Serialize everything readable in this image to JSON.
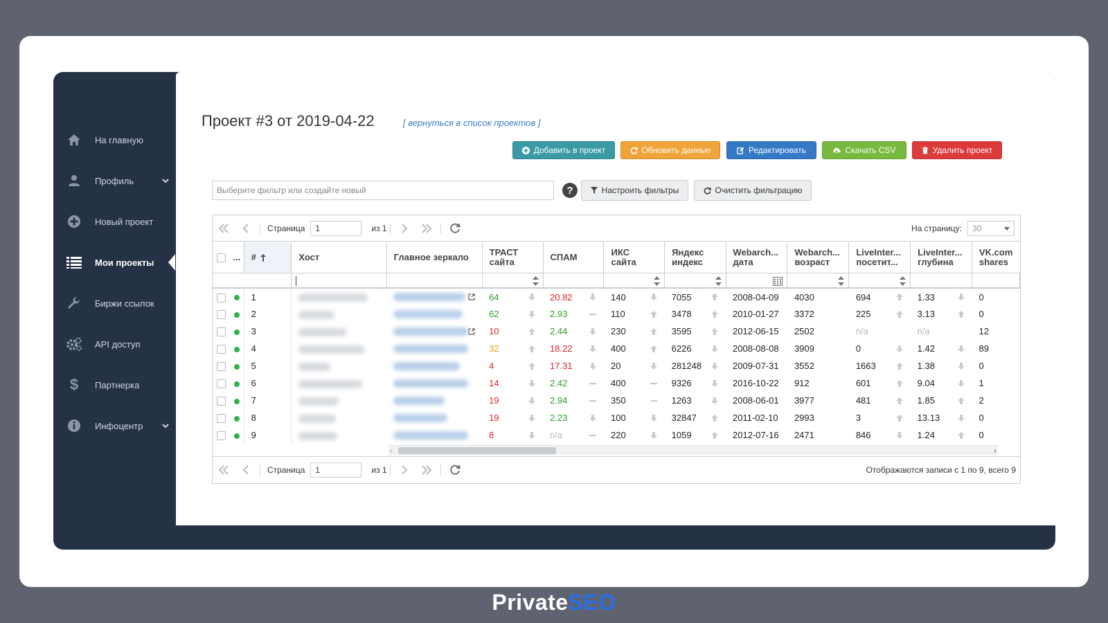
{
  "sidebar": {
    "items": [
      {
        "label": "На главную",
        "icon": "home-icon"
      },
      {
        "label": "Профиль",
        "icon": "user-icon"
      },
      {
        "label": "Новый проект",
        "icon": "plus-circle-icon"
      },
      {
        "label": "Мои проекты",
        "icon": "list-icon",
        "active": true
      },
      {
        "label": "Биржи ссылок",
        "icon": "wrench-icon"
      },
      {
        "label": "API доступ",
        "icon": "gears-icon"
      },
      {
        "label": "Партнерка",
        "icon": "dollar-icon"
      },
      {
        "label": "Инфоцентр",
        "icon": "info-icon"
      }
    ]
  },
  "header": {
    "title": "Проект #3 от 2019-04-22",
    "back_link": "[ вернуться в список проектов ]"
  },
  "toolbar": {
    "add": "Добавить в проект",
    "refresh": "Обновить данные",
    "edit": "Редактировать",
    "csv": "Скачать CSV",
    "delete": "Удалить проект"
  },
  "filters": {
    "placeholder": "Выберите фильтр или создайте новый",
    "configure": "Настроить фильтры",
    "clear": "Очистить фильтрацию"
  },
  "pager": {
    "page_label": "Страница",
    "page_value": "1",
    "of_label": "из 1",
    "per_page_label": "На страницу:",
    "per_page_value": "30",
    "info": "Отображаются записи с 1 по 9, всего 9"
  },
  "table": {
    "columns": {
      "dots": "...",
      "idx": "#",
      "host": "Хост",
      "mirror": "Главное зеркало",
      "trust": [
        "ТРАСТ",
        "сайта"
      ],
      "spam": "СПАМ",
      "iks": [
        "ИКС",
        "сайта"
      ],
      "yandex": [
        "Яндекс",
        "индекс"
      ],
      "wa_date": [
        "Webarch...",
        "дата"
      ],
      "wa_age": [
        "Webarch...",
        "возраст"
      ],
      "li_visits": [
        "LiveInter...",
        "посетит..."
      ],
      "li_depth": [
        "LiveInter...",
        "глубина"
      ],
      "vk": [
        "VK.com",
        "shares"
      ]
    },
    "rows": [
      {
        "n": "1",
        "trust": "64",
        "trust_c": "green",
        "trust_a": "down",
        "spam": "20.82",
        "spam_c": "red",
        "spam_a": "down",
        "iks": "140",
        "iks_a": "down",
        "yx": "7055",
        "yx_a": "up",
        "wd": "2008-04-09",
        "wa": "4030",
        "lv": "694",
        "lv_a": "up",
        "ld": "1.33",
        "ld_a": "down",
        "vk": "0",
        "hw": 100,
        "mw": 104,
        "ext": true
      },
      {
        "n": "2",
        "trust": "62",
        "trust_c": "green",
        "trust_a": "down",
        "spam": "2.93",
        "spam_c": "green",
        "spam_a": "dash",
        "iks": "110",
        "iks_a": "up",
        "yx": "3478",
        "yx_a": "up",
        "wd": "2010-01-27",
        "wa": "3372",
        "lv": "225",
        "lv_a": "up",
        "ld": "3.13",
        "ld_a": "up",
        "vk": "0",
        "hw": 52,
        "mw": 100,
        "ext": false
      },
      {
        "n": "3",
        "trust": "10",
        "trust_c": "red",
        "trust_a": "up",
        "spam": "2.44",
        "spam_c": "green",
        "spam_a": "down",
        "iks": "230",
        "iks_a": "up",
        "yx": "3595",
        "yx_a": "up",
        "wd": "2012-06-15",
        "wa": "2502",
        "lv": "n/a",
        "lv_a": "",
        "ld": "n/a",
        "ld_a": "",
        "vk": "12",
        "hw": 70,
        "mw": 108,
        "ext": true
      },
      {
        "n": "4",
        "trust": "32",
        "trust_c": "orange",
        "trust_a": "up",
        "spam": "18.22",
        "spam_c": "red",
        "spam_a": "down",
        "iks": "400",
        "iks_a": "up",
        "yx": "6226",
        "yx_a": "down",
        "wd": "2008-08-08",
        "wa": "3909",
        "lv": "0",
        "lv_a": "down",
        "ld": "1.42",
        "ld_a": "down",
        "vk": "89",
        "hw": 96,
        "mw": 108,
        "ext": false
      },
      {
        "n": "5",
        "trust": "4",
        "trust_c": "red",
        "trust_a": "up",
        "spam": "17.31",
        "spam_c": "red",
        "spam_a": "down",
        "iks": "20",
        "iks_a": "down",
        "yx": "281248",
        "yx_a": "down",
        "wd": "2009-07-31",
        "wa": "3552",
        "lv": "1663",
        "lv_a": "up",
        "ld": "1.38",
        "ld_a": "down",
        "vk": "0",
        "hw": 46,
        "mw": 96,
        "ext": false
      },
      {
        "n": "6",
        "trust": "14",
        "trust_c": "red",
        "trust_a": "down",
        "spam": "2.42",
        "spam_c": "green",
        "spam_a": "dash",
        "iks": "400",
        "iks_a": "dash",
        "yx": "9326",
        "yx_a": "down",
        "wd": "2016-10-22",
        "wa": "912",
        "lv": "601",
        "lv_a": "up",
        "ld": "9.04",
        "ld_a": "down",
        "vk": "1",
        "hw": 92,
        "mw": 108,
        "ext": false
      },
      {
        "n": "7",
        "trust": "19",
        "trust_c": "red",
        "trust_a": "down",
        "spam": "2.94",
        "spam_c": "green",
        "spam_a": "dash",
        "iks": "350",
        "iks_a": "dash",
        "yx": "1263",
        "yx_a": "down",
        "wd": "2008-06-01",
        "wa": "3977",
        "lv": "481",
        "lv_a": "up",
        "ld": "1.85",
        "ld_a": "up",
        "vk": "2",
        "hw": 58,
        "mw": 74,
        "ext": false
      },
      {
        "n": "8",
        "trust": "19",
        "trust_c": "red",
        "trust_a": "down",
        "spam": "2.23",
        "spam_c": "green",
        "spam_a": "down",
        "iks": "100",
        "iks_a": "down",
        "yx": "32847",
        "yx_a": "up",
        "wd": "2011-02-10",
        "wa": "2993",
        "lv": "3",
        "lv_a": "up",
        "ld": "13.13",
        "ld_a": "down",
        "vk": "0",
        "hw": 54,
        "mw": 78,
        "ext": false
      },
      {
        "n": "9",
        "trust": "8",
        "trust_c": "red",
        "trust_a": "down",
        "spam": "n/a",
        "spam_c": "na",
        "spam_a": "dash",
        "iks": "220",
        "iks_a": "down",
        "yx": "1059",
        "yx_a": "up",
        "wd": "2012-07-16",
        "wa": "2471",
        "lv": "846",
        "lv_a": "down",
        "ld": "1.24",
        "ld_a": "up",
        "vk": "0",
        "hw": 56,
        "mw": 108,
        "ext": false
      }
    ]
  },
  "brand": {
    "part1": "Private",
    "part2": "SEO"
  }
}
